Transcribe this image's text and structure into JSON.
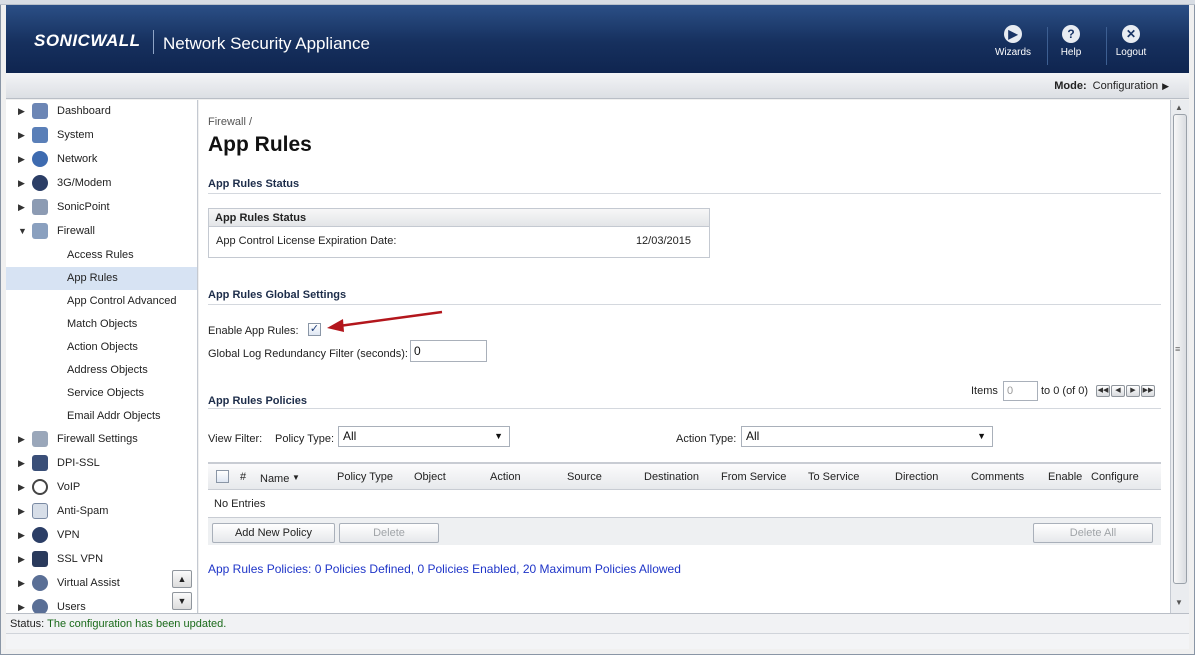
{
  "header": {
    "logo": "SONICWALL",
    "title": "Network Security Appliance",
    "buttons": [
      {
        "label": "Wizards",
        "icon": "wizard-icon"
      },
      {
        "label": "Help",
        "icon": "help-icon"
      },
      {
        "label": "Logout",
        "icon": "logout-icon"
      }
    ]
  },
  "modebar": {
    "label": "Mode:",
    "value": "Configuration"
  },
  "sidebar": {
    "items": [
      {
        "label": "Dashboard",
        "icon": "dashboard-icon"
      },
      {
        "label": "System",
        "icon": "system-icon"
      },
      {
        "label": "Network",
        "icon": "network-icon"
      },
      {
        "label": "3G/Modem",
        "icon": "modem-icon"
      },
      {
        "label": "SonicPoint",
        "icon": "sonicpoint-icon"
      },
      {
        "label": "Firewall",
        "icon": "firewall-icon"
      },
      {
        "label": "Firewall Settings",
        "icon": "firewall-settings-icon"
      },
      {
        "label": "DPI-SSL",
        "icon": "dpi-ssl-icon"
      },
      {
        "label": "VoIP",
        "icon": "voip-icon"
      },
      {
        "label": "Anti-Spam",
        "icon": "anti-spam-icon"
      },
      {
        "label": "VPN",
        "icon": "vpn-icon"
      },
      {
        "label": "SSL VPN",
        "icon": "ssl-vpn-icon"
      },
      {
        "label": "Virtual Assist",
        "icon": "virtual-assist-icon"
      },
      {
        "label": "Users",
        "icon": "users-icon"
      }
    ],
    "firewall_sub": [
      "Access Rules",
      "App Rules",
      "App Control Advanced",
      "Match Objects",
      "Action Objects",
      "Address Objects",
      "Service Objects",
      "Email Addr Objects"
    ]
  },
  "main": {
    "breadcrumb": "Firewall /",
    "title": "App Rules",
    "status_section": "App Rules Status",
    "status_box": {
      "header": "App Rules Status",
      "row_label": "App Control License Expiration Date:",
      "row_value": "12/03/2015"
    },
    "global_section": "App Rules Global Settings",
    "enable_label": "Enable App Rules:",
    "enable_checked": true,
    "log_filter_label": "Global Log Redundancy Filter (seconds):",
    "log_filter_value": "0",
    "policies_section": "App Rules Policies",
    "pager": {
      "label": "Items",
      "input_value": "0",
      "range": "to 0 (of 0)"
    },
    "view_filter_label": "View Filter:",
    "policy_type_label": "Policy Type:",
    "policy_type_value": "All",
    "action_type_label": "Action Type:",
    "action_type_value": "All",
    "columns": [
      "#",
      "Name",
      "Policy Type",
      "Object",
      "Action",
      "Source",
      "Destination",
      "From Service",
      "To Service",
      "Direction",
      "Comments",
      "Enable",
      "Configure"
    ],
    "no_entries": "No Entries",
    "add_button": "Add New Policy",
    "delete_button": "Delete",
    "delete_all_button": "Delete All",
    "summary": "App Rules Policies:  0 Policies Defined, 0 Policies Enabled, 20 Maximum Policies Allowed"
  },
  "statusbar": {
    "label": "Status:",
    "message": "The configuration has been updated."
  },
  "colors": {
    "header_blue": "#16305e",
    "link_blue": "#1f35c8",
    "arrow_red": "#b3161c",
    "selected_row": "#d7e3f3"
  }
}
